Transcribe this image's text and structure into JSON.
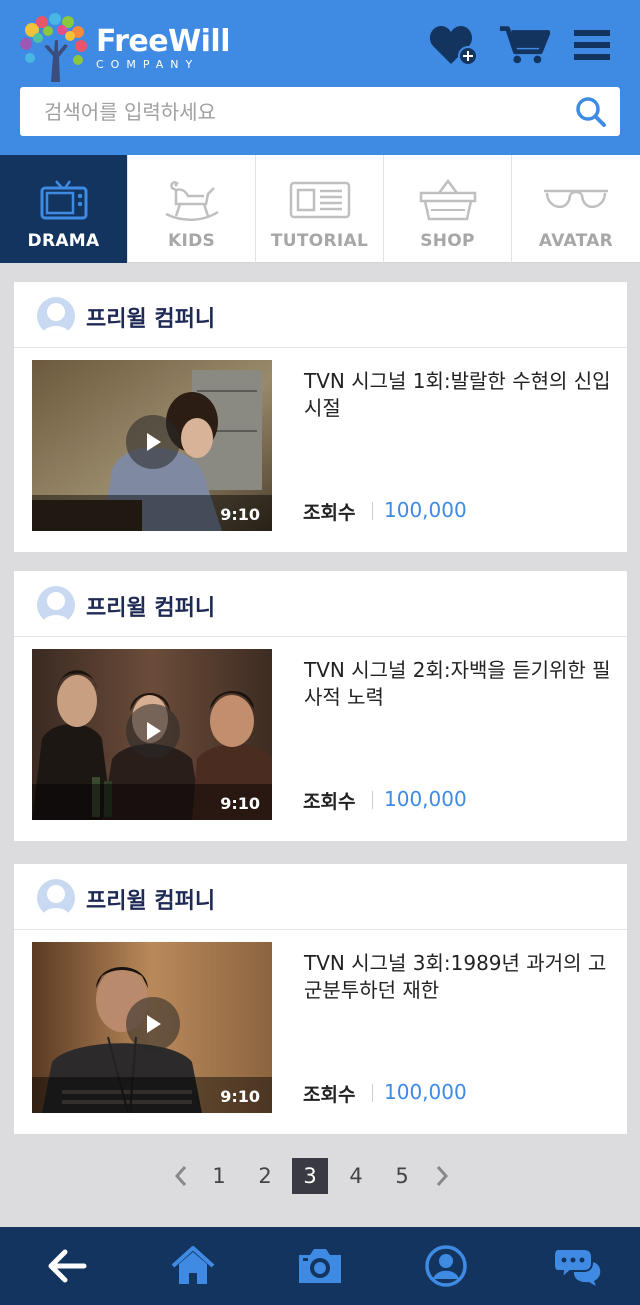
{
  "brand": {
    "name": "FreeWill",
    "tagline": "COMPANY"
  },
  "header": {
    "icons": [
      "heart-add-icon",
      "cart-icon",
      "hamburger-menu-icon"
    ],
    "colors": {
      "primary": "#3f8be4",
      "navy": "#12345f"
    }
  },
  "search": {
    "placeholder": "검색어를 입력하세요",
    "value": ""
  },
  "tabs": [
    {
      "label": "DRAMA",
      "icon": "tv-icon",
      "active": true
    },
    {
      "label": "KIDS",
      "icon": "rocking-horse-icon",
      "active": false
    },
    {
      "label": "TUTORIAL",
      "icon": "newspaper-icon",
      "active": false
    },
    {
      "label": "SHOP",
      "icon": "basket-icon",
      "active": false
    },
    {
      "label": "AVATAR",
      "icon": "glasses-icon",
      "active": false
    }
  ],
  "videos": [
    {
      "channel": "프리윌 컴퍼니",
      "title": "TVN 시그널 1회:발랄한 수현의 신입시절",
      "duration": "9:10",
      "views_label": "조회수",
      "views": "100,000"
    },
    {
      "channel": "프리윌 컴퍼니",
      "title": "TVN 시그널 2회:자백을 듣기위한 필사적 노력",
      "duration": "9:10",
      "views_label": "조회수",
      "views": "100,000"
    },
    {
      "channel": "프리윌 컴퍼니",
      "title": "TVN 시그널 3회:1989년 과거의 고군분투하던 재한",
      "duration": "9:10",
      "views_label": "조회수",
      "views": "100,000"
    }
  ],
  "pagination": {
    "pages": [
      "1",
      "2",
      "3",
      "4",
      "5"
    ],
    "current": "3",
    "prev": "‹",
    "next": "›"
  },
  "bottom_nav": [
    "back-arrow-icon",
    "home-icon",
    "camera-icon",
    "profile-icon",
    "chat-icon"
  ]
}
